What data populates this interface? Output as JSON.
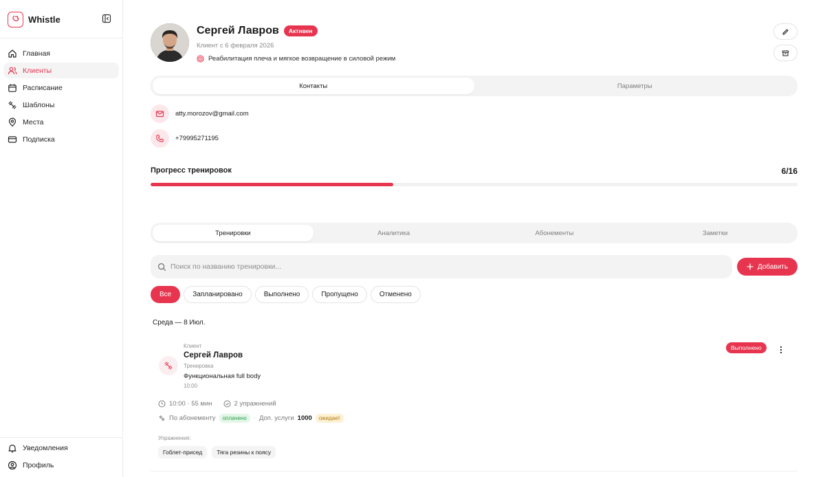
{
  "app": {
    "name": "Whistle"
  },
  "colors": {
    "accent": "#e8354f",
    "accent_soft": "#fce7ea",
    "success": "#2a9d4b",
    "warning": "#b07a10"
  },
  "sidebar": {
    "items": [
      {
        "label": "Главная",
        "icon": "home-icon"
      },
      {
        "label": "Клиенты",
        "icon": "users-icon",
        "active": true
      },
      {
        "label": "Расписание",
        "icon": "calendar-icon"
      },
      {
        "label": "Шаблоны",
        "icon": "dumbbell-icon"
      },
      {
        "label": "Места",
        "icon": "location-pin-icon"
      },
      {
        "label": "Подписка",
        "icon": "credit-card-icon"
      }
    ],
    "bottom_items": [
      {
        "label": "Уведомления",
        "icon": "bell-icon"
      },
      {
        "label": "Профиль",
        "icon": "user-circle-icon"
      }
    ]
  },
  "client": {
    "name": "Сергей Лавров",
    "status": "Активен",
    "since": "Клиент с 6 февраля 2026",
    "goal": "Реабилитация плеча и мягкое возвращение в силовой режим"
  },
  "info_tabs": [
    {
      "label": "Контакты",
      "active": true
    },
    {
      "label": "Параметры",
      "active": false
    }
  ],
  "contacts": {
    "email": "atty.morozov@gmail.com",
    "phone": "+79995271195"
  },
  "progress": {
    "title": "Прогресс тренировок",
    "count_label": "6/16",
    "done": 6,
    "total": 16,
    "fraction": 0.375
  },
  "section_tabs": [
    {
      "label": "Тренировки",
      "active": true
    },
    {
      "label": "Аналитика",
      "active": false
    },
    {
      "label": "Абонементы",
      "active": false
    },
    {
      "label": "Заметки",
      "active": false
    }
  ],
  "search": {
    "placeholder": "Поиск по названию тренировки...",
    "value": ""
  },
  "add_button": "Добавить",
  "filters": [
    {
      "label": "Все",
      "active": true
    },
    {
      "label": "Запланировано",
      "active": false
    },
    {
      "label": "Выполнено",
      "active": false
    },
    {
      "label": "Пропущено",
      "active": false
    },
    {
      "label": "Отменено",
      "active": false
    }
  ],
  "day_label": "Среда — 8 Июл.",
  "session": {
    "client_label": "Клиент",
    "client_name": "Сергей Лавров",
    "workout_label": "Тренировка",
    "workout_name": "Функциональная full body",
    "time": "10:00",
    "status": "Выполнено",
    "time_duration": "10:00 · 55 мин",
    "exercises_count": "2 упражнений",
    "payment_label": "По абонементу",
    "payment_status": "оплачено",
    "extra_label": "Доп. услуги",
    "extra_amount": "1000",
    "extra_status": "ожидает",
    "exercises_label": "Упражнения:",
    "exercises": [
      "Гоблет-присед",
      "Тяга резины к поясу"
    ]
  }
}
